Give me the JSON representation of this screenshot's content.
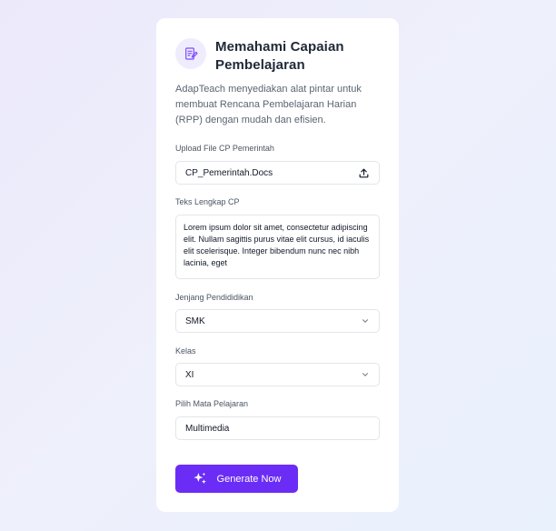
{
  "card": {
    "title": "Memahami Capaian Pembelajaran",
    "description": "AdapTeach menyediakan alat pintar untuk membuat Rencana Pembelajaran Harian (RPP) dengan mudah dan efisien.",
    "header_icon": "document-edit-icon"
  },
  "upload": {
    "label": "Upload File CP Pemerintah",
    "value": "CP_Pemerintah.Docs",
    "icon": "upload-icon"
  },
  "cp_text": {
    "label": "Teks Lengkap CP",
    "value": "Lorem ipsum dolor sit amet, consectetur adipiscing elit. Nullam sagittis purus vitae elit cursus, id iaculis elit scelerisque. Integer bibendum nunc nec nibh lacinia, eget"
  },
  "jenjang": {
    "label": "Jenjang Pendididikan",
    "value": "SMK",
    "icon": "chevron-down-icon"
  },
  "kelas": {
    "label": "Kelas",
    "value": "XI",
    "icon": "chevron-down-icon"
  },
  "mapel": {
    "label": "Pilih Mata Pelajaran",
    "value": "Multimedia"
  },
  "generate": {
    "label": "Generate Now",
    "icon": "sparkles-icon"
  },
  "colors": {
    "accent": "#6b2cf6",
    "icon_bg": "#efecfd"
  }
}
